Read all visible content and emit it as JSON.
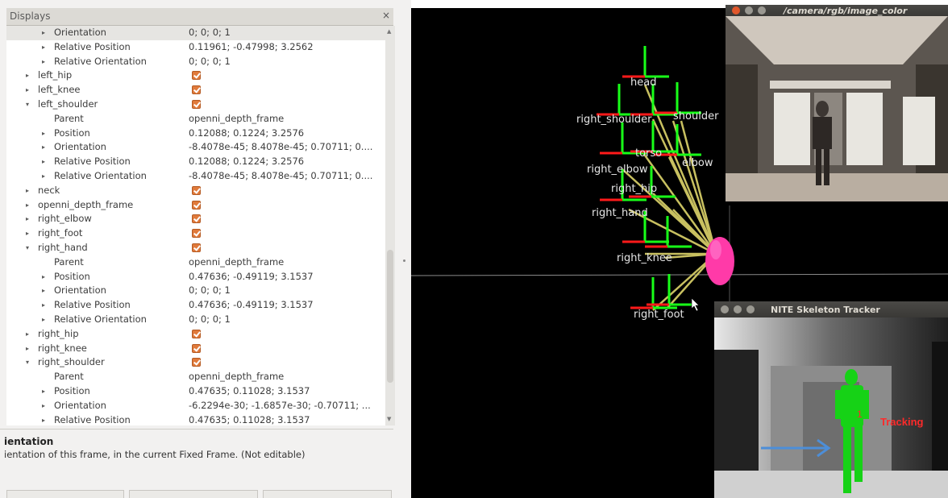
{
  "displays_panel": {
    "title": "Displays",
    "close_glyph": "×",
    "rows": [
      {
        "indent": 2,
        "arrow": "▸",
        "name": "Orientation",
        "value": "0; 0; 0; 1",
        "selected": true
      },
      {
        "indent": 2,
        "arrow": "▸",
        "name": "Relative Position",
        "value": "0.11961; -0.47998; 3.2562"
      },
      {
        "indent": 2,
        "arrow": "▸",
        "name": "Relative Orientation",
        "value": "0; 0; 0; 1"
      },
      {
        "indent": 1,
        "arrow": "▸",
        "name": "left_hip",
        "checkbox": true
      },
      {
        "indent": 1,
        "arrow": "▸",
        "name": "left_knee",
        "checkbox": true
      },
      {
        "indent": 1,
        "arrow": "▾",
        "name": "left_shoulder",
        "checkbox": true
      },
      {
        "indent": 2,
        "arrow": "",
        "name": "Parent",
        "value": "openni_depth_frame"
      },
      {
        "indent": 2,
        "arrow": "▸",
        "name": "Position",
        "value": "0.12088; 0.1224; 3.2576"
      },
      {
        "indent": 2,
        "arrow": "▸",
        "name": "Orientation",
        "value": "-8.4078e-45; 8.4078e-45; 0.70711; 0...."
      },
      {
        "indent": 2,
        "arrow": "▸",
        "name": "Relative Position",
        "value": "0.12088; 0.1224; 3.2576"
      },
      {
        "indent": 2,
        "arrow": "▸",
        "name": "Relative Orientation",
        "value": "-8.4078e-45; 8.4078e-45; 0.70711; 0...."
      },
      {
        "indent": 1,
        "arrow": "▸",
        "name": "neck",
        "checkbox": true
      },
      {
        "indent": 1,
        "arrow": "▸",
        "name": "openni_depth_frame",
        "checkbox": true
      },
      {
        "indent": 1,
        "arrow": "▸",
        "name": "right_elbow",
        "checkbox": true
      },
      {
        "indent": 1,
        "arrow": "▸",
        "name": "right_foot",
        "checkbox": true
      },
      {
        "indent": 1,
        "arrow": "▾",
        "name": "right_hand",
        "checkbox": true
      },
      {
        "indent": 2,
        "arrow": "",
        "name": "Parent",
        "value": "openni_depth_frame"
      },
      {
        "indent": 2,
        "arrow": "▸",
        "name": "Position",
        "value": "0.47636; -0.49119; 3.1537"
      },
      {
        "indent": 2,
        "arrow": "▸",
        "name": "Orientation",
        "value": "0; 0; 0; 1"
      },
      {
        "indent": 2,
        "arrow": "▸",
        "name": "Relative Position",
        "value": "0.47636; -0.49119; 3.1537"
      },
      {
        "indent": 2,
        "arrow": "▸",
        "name": "Relative Orientation",
        "value": "0; 0; 0; 1"
      },
      {
        "indent": 1,
        "arrow": "▸",
        "name": "right_hip",
        "checkbox": true
      },
      {
        "indent": 1,
        "arrow": "▸",
        "name": "right_knee",
        "checkbox": true
      },
      {
        "indent": 1,
        "arrow": "▾",
        "name": "right_shoulder",
        "checkbox": true
      },
      {
        "indent": 2,
        "arrow": "",
        "name": "Parent",
        "value": "openni_depth_frame"
      },
      {
        "indent": 2,
        "arrow": "▸",
        "name": "Position",
        "value": "0.47635; 0.11028; 3.1537"
      },
      {
        "indent": 2,
        "arrow": "▸",
        "name": "Orientation",
        "value": "-6.2294e-30; -1.6857e-30; -0.70711; ..."
      },
      {
        "indent": 2,
        "arrow": "▸",
        "name": "Relative Position",
        "value": "0.47635; 0.11028; 3.1537"
      }
    ]
  },
  "description": {
    "title": "ientation",
    "text": "ientation of this frame, in the current Fixed Frame. (Not editable)"
  },
  "view3d": {
    "frame_labels": [
      "head",
      "right_shoulder",
      "shoulder",
      "torso",
      "right_elbow",
      "elbow",
      "right_hip",
      "right_hand",
      "right_knee",
      "right_foot"
    ]
  },
  "rgb_window": {
    "title": "/camera/rgb/image_color"
  },
  "nite_window": {
    "title": "NITE Skeleton Tracker",
    "user_id": "1",
    "status": "Tracking"
  },
  "colors": {
    "selection": "#e6e5e2",
    "checkbox": "#e07a3b",
    "axis_red": "#ff1a1a",
    "axis_green": "#18ff18",
    "tf_link": "#c8c060",
    "root_frame": "#ff3aa8",
    "label_text": "#e6e6e6",
    "tracking_green": "#16d216",
    "tracking_text": "#ff2a2a",
    "arrow_blue": "#4d8ed8",
    "close_dot": "#e0572b",
    "inactive_dot": "#9a9891"
  },
  "icons": [
    "expand-arrow-icon",
    "collapse-arrow-icon",
    "checkbox-checked-icon",
    "close-icon",
    "mouse-cursor-icon"
  ]
}
